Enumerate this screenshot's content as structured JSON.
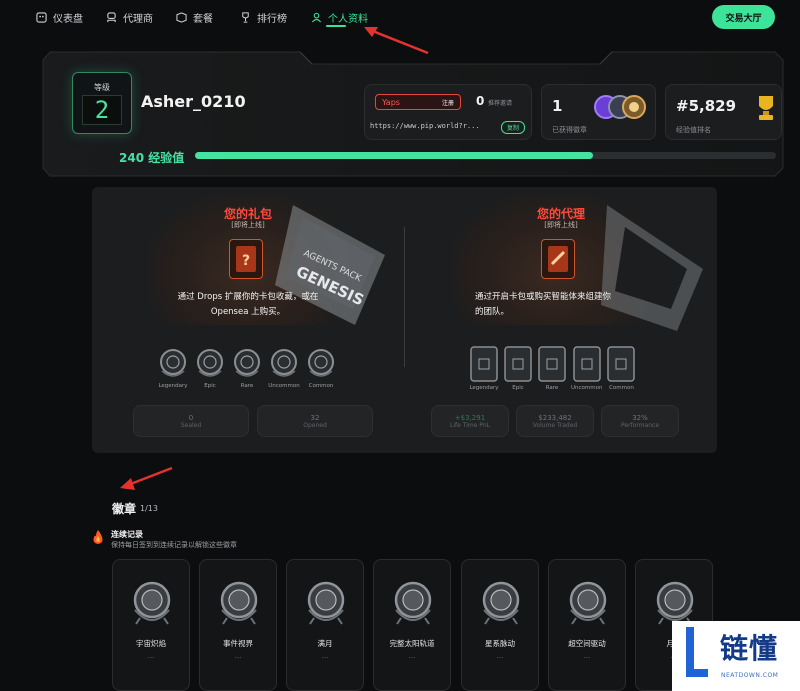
{
  "nav": {
    "items": [
      {
        "label": "仪表盘",
        "icon": "dashboard-icon"
      },
      {
        "label": "代理商",
        "icon": "agent-icon"
      },
      {
        "label": "套餐",
        "icon": "package-icon"
      },
      {
        "label": "排行榜",
        "icon": "trophy-icon"
      },
      {
        "label": "个人资料",
        "icon": "user-icon",
        "active": true
      }
    ],
    "trade_button": "交易大厅"
  },
  "profile": {
    "level_label": "等级",
    "level": "2",
    "username": "Asher_0210",
    "yaps_label": "Yaps",
    "register_label": "注册",
    "referral_count": "0",
    "referral_label": "推荐邀请",
    "referral_link": "https://www.pip.world?r...",
    "copy_label": "复制",
    "badges_value": "1",
    "badges_label": "已获得徽章",
    "rank_value": "#5,829",
    "rank_label": "经验值排名",
    "xp_label": "240 经验值",
    "xp_progress": 0.685
  },
  "packs": {
    "title": "您的礼包",
    "subtitle": "[即将上线]",
    "description_lines": [
      "通过 Drops 扩展你的卡包收藏，或在",
      "Opensea 上购买。"
    ],
    "tiers": [
      "Legendary",
      "Epic",
      "Rare",
      "Uncommon",
      "Common"
    ],
    "stats": [
      {
        "value": "0",
        "label": "Sealed"
      },
      {
        "value": "32",
        "label": "Opened"
      }
    ]
  },
  "agents": {
    "title": "您的代理",
    "subtitle": "[即将上线]",
    "description_lines": [
      "通过开启卡包或购买智能体来组建你",
      "的团队。"
    ],
    "tiers": [
      "Legendary",
      "Epic",
      "Rare",
      "Uncommon",
      "Common"
    ],
    "stats": [
      {
        "value": "+$3,291",
        "label": "Life Time PnL"
      },
      {
        "value": "$233,482",
        "label": "Volume Traded"
      },
      {
        "value": "32%",
        "label": "Performance"
      }
    ]
  },
  "badges": {
    "title": "徽章",
    "count": "1/13",
    "streak_title": "连续记录",
    "streak_desc": "保持每日签到到连续记录以解锁这些徽章",
    "items": [
      {
        "name": "宇宙炽焰",
        "sub": "..."
      },
      {
        "name": "事件视界",
        "sub": "..."
      },
      {
        "name": "满月",
        "sub": "..."
      },
      {
        "name": "完整太阳轨道",
        "sub": "..."
      },
      {
        "name": "星系脉动",
        "sub": "..."
      },
      {
        "name": "超空间驱动",
        "sub": "..."
      },
      {
        "name": "月相",
        "sub": "..."
      }
    ]
  },
  "watermark": {
    "text": "链懂",
    "sub": "NEATDOWN.COM"
  },
  "colors": {
    "accent": "#3ee39a",
    "red": "#ff4a3d",
    "background": "#0c0d0e"
  }
}
